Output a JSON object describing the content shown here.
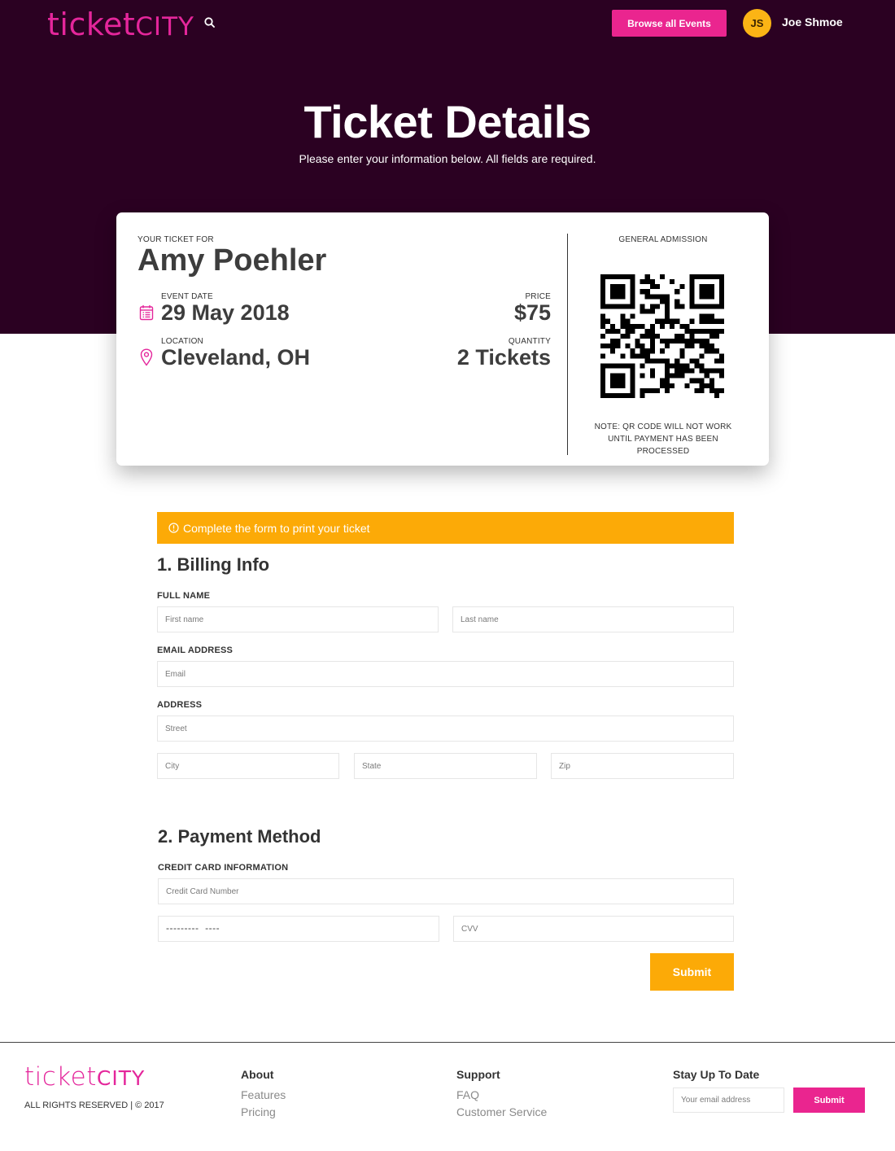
{
  "header": {
    "logo_part1": "ticket",
    "logo_part2": "CITY",
    "browse_label": "Browse all Events",
    "avatar_initials": "JS",
    "user_name": "Joe Shmoe"
  },
  "hero": {
    "title": "Ticket Details",
    "subtitle": "Please enter your information below. All fields are required."
  },
  "ticket": {
    "for_label": "YOUR TICKET FOR",
    "name": "Amy Poehler",
    "date_label": "EVENT DATE",
    "date": "29 May 2018",
    "location_label": "LOCATION",
    "location": "Cleveland, OH",
    "price_label": "PRICE",
    "price": "$75",
    "quantity_label": "QUANTITY",
    "quantity": "2 Tickets",
    "admission": "GENERAL ADMISSION",
    "note": "NOTE: QR CODE WILL NOT WORK UNTIL PAYMENT HAS BEEN PROCESSED"
  },
  "alert": {
    "text": "Complete the form to print your ticket"
  },
  "billing": {
    "title": "1. Billing Info",
    "full_name_label": "FULL NAME",
    "first_placeholder": "First name",
    "last_placeholder": "Last name",
    "email_label": "EMAIL ADDRESS",
    "email_placeholder": "Email",
    "address_label": "ADDRESS",
    "street_placeholder": "Street",
    "city_placeholder": "City",
    "state_placeholder": "State",
    "zip_placeholder": "Zip"
  },
  "payment": {
    "title": "2. Payment Method",
    "cc_label": "CREDIT CARD INFORMATION",
    "cc_placeholder": "Credit Card Number",
    "exp_placeholder": "---------  ----",
    "cvv_placeholder": "CVV",
    "submit_label": "Submit"
  },
  "footer": {
    "logo_part1": "ticket",
    "logo_part2": "CITY",
    "rights": "ALL RIGHTS RESERVED | © 2017",
    "about_title": "About",
    "about_links": [
      "Features",
      "Pricing"
    ],
    "support_title": "Support",
    "support_links": [
      "FAQ",
      "Customer Service"
    ],
    "newsletter_title": "Stay Up To Date",
    "newsletter_placeholder": "Your email address",
    "newsletter_button": "Submit"
  },
  "colors": {
    "hero_bg": "#2b0122",
    "brand_pink": "#ea258f",
    "accent_orange": "#fcaa07",
    "avatar_yellow": "#fbb415"
  },
  "icons": {
    "search": "search-icon",
    "calendar": "calendar-icon",
    "location": "location-pin-icon",
    "alert": "info-circle-icon",
    "qr": "qr-code-icon"
  }
}
